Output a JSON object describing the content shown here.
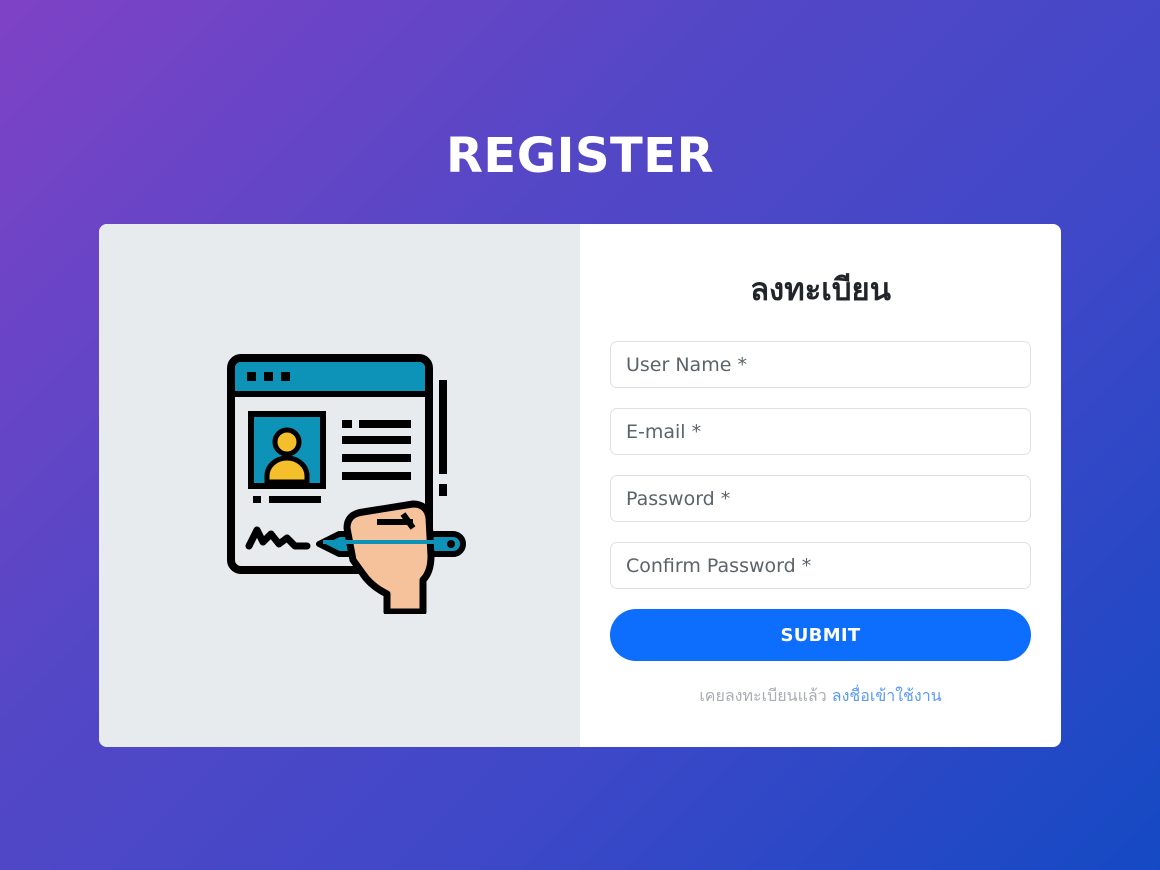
{
  "page": {
    "title": "REGISTER"
  },
  "form": {
    "title": "ลงทะเบียน",
    "fields": {
      "username_placeholder": "User Name *",
      "email_placeholder": "E-mail *",
      "password_placeholder": "Password *",
      "confirm_password_placeholder": "Confirm Password *"
    },
    "submit_label": "SUBMIT",
    "footer_text": "เคยลงทะเบียนแล้ว",
    "login_link": "ลงชื่อเข้าใช้งาน"
  },
  "illustration": {
    "icon": "register-form-signature-icon"
  },
  "colors": {
    "accent": "#0d6efd",
    "link": "#5b9af7",
    "panel_left": "#e8ebee",
    "icon_header": "#0e93b8",
    "icon_person": "#f5bf2c",
    "icon_hand": "#f6c29c"
  }
}
